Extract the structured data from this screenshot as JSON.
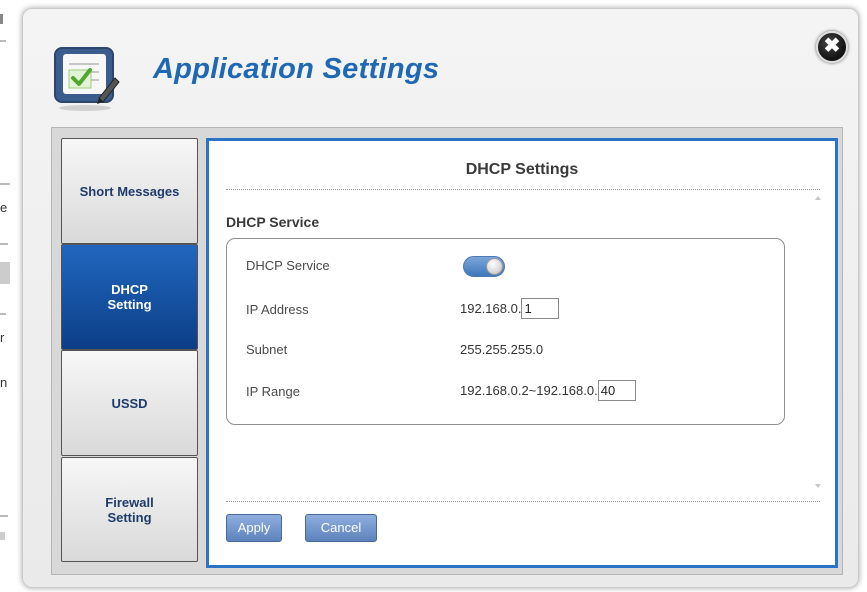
{
  "dialog": {
    "title": "Application Settings",
    "close_symbol": "✖"
  },
  "background_fragments": [
    "e",
    "r",
    "n"
  ],
  "tabs": [
    {
      "label": "Short Messages",
      "active": false
    },
    {
      "label": "DHCP\nSetting",
      "active": true
    },
    {
      "label": "USSD",
      "active": false
    },
    {
      "label": "Firewall\nSetting",
      "active": false
    }
  ],
  "panel": {
    "title": "DHCP Settings",
    "section_title": "DHCP Service",
    "rows": {
      "dhcp_service": {
        "label": "DHCP Service",
        "enabled": true
      },
      "ip_address": {
        "label": "IP Address",
        "prefix": "192.168.0.",
        "value": "1"
      },
      "subnet": {
        "label": "Subnet",
        "value": "255.255.255.0"
      },
      "ip_range": {
        "label": "IP Range",
        "prefix": "192.168.0.2~192.168.0.",
        "value": "40"
      }
    },
    "apply_label": "Apply",
    "cancel_label": "Cancel"
  },
  "colors": {
    "accent": "#1f68b3",
    "active_tab": "#1a5aae",
    "panel_border": "#2a74c8",
    "button": "#6f92c9"
  },
  "icons": {
    "app": "checklist-clipboard-icon",
    "close": "close-icon",
    "toggle": "toggle-switch"
  }
}
